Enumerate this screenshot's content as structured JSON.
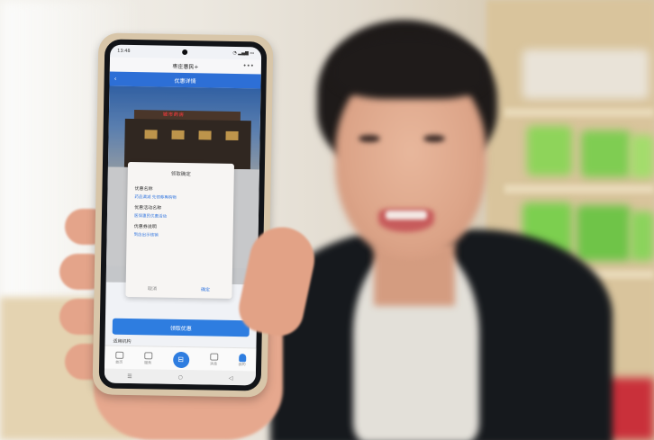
{
  "phone": {
    "status_time": "13:48",
    "status_icons": "◔ ▂▄▆ ▭",
    "app_title": "枣庄惠民+",
    "more_icon": "more-icon",
    "header_title": "优惠详情",
    "back_icon": "back-arrow-icon",
    "banner_sign": "城市药房",
    "dialog": {
      "title": "领取确定",
      "fields": [
        {
          "label": "优惠名称",
          "value": "药品满减 先领券再购物"
        },
        {
          "label": "优惠活动名称",
          "value": "医保惠民优惠活动"
        },
        {
          "label": "优惠券说明",
          "value": "到店出示核销"
        }
      ],
      "cancel_label": "取消",
      "confirm_label": "确定"
    },
    "claim_button_label": "领取优惠",
    "section_label": "适用机构",
    "nav": [
      {
        "label": "首页"
      },
      {
        "label": "服务"
      },
      {
        "label": ""
      },
      {
        "label": "消息"
      },
      {
        "label": "我的"
      }
    ],
    "sys_nav": [
      "☰",
      "○",
      "◁"
    ]
  },
  "colors": {
    "accent_blue": "#2e7de0",
    "header_blue": "#2d6fd6",
    "phone_case": "#d8c6a9",
    "jacket": "#16191d"
  }
}
